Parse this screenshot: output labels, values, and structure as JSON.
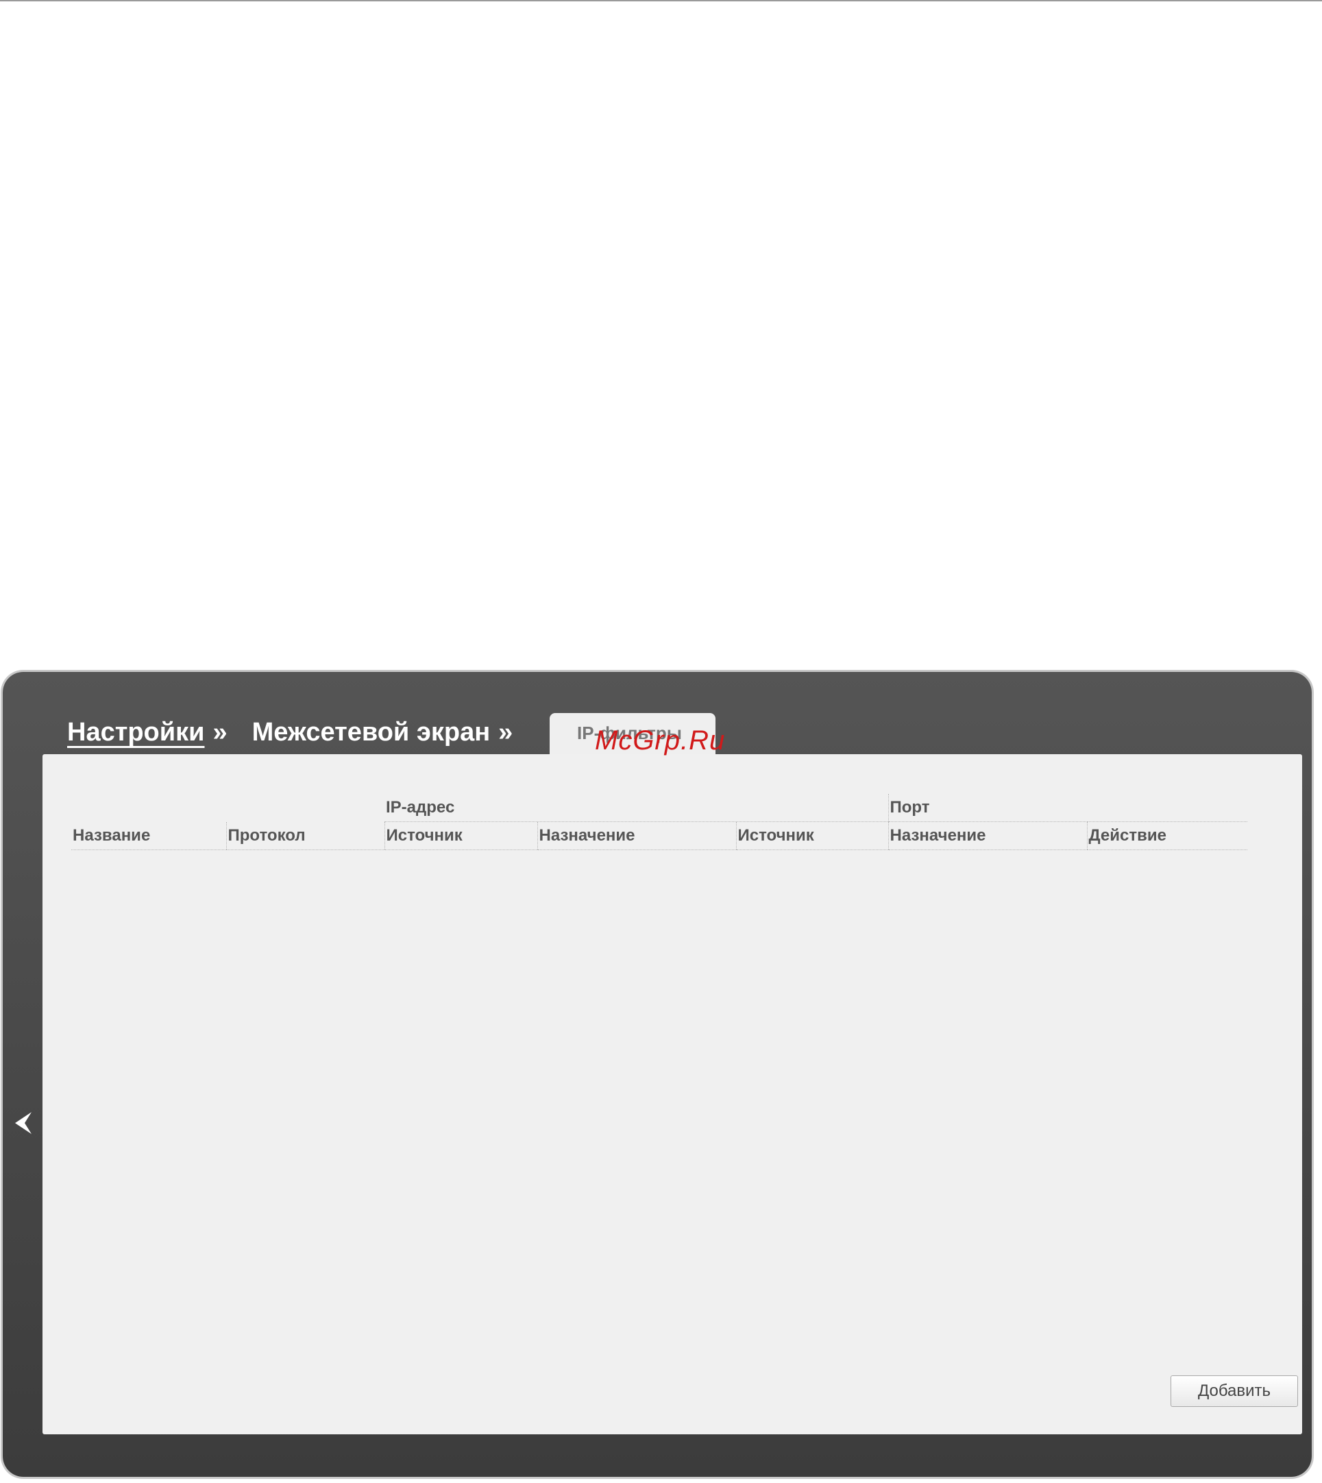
{
  "breadcrumb": {
    "items": [
      {
        "label": "Настройки",
        "separator": "»"
      },
      {
        "label": "Межсетевой экран",
        "separator": "»"
      }
    ]
  },
  "tab": {
    "label": "IP-фильтры"
  },
  "watermark": {
    "text": "McGrp.Ru"
  },
  "table": {
    "groups": {
      "ip_address": "IP-адрес",
      "port": "Порт"
    },
    "columns": {
      "name": "Название",
      "protocol": "Протокол",
      "ip_source": "Источник",
      "ip_destination": "Назначение",
      "port_source": "Источник",
      "port_destination": "Назначение",
      "action": "Действие"
    },
    "rows": []
  },
  "buttons": {
    "add_label": "Добавить"
  },
  "icons": {
    "back": "chevron-left-icon"
  },
  "colors": {
    "frame": "#444444",
    "panel": "#f0f0f0",
    "watermark": "#d11a1a"
  }
}
